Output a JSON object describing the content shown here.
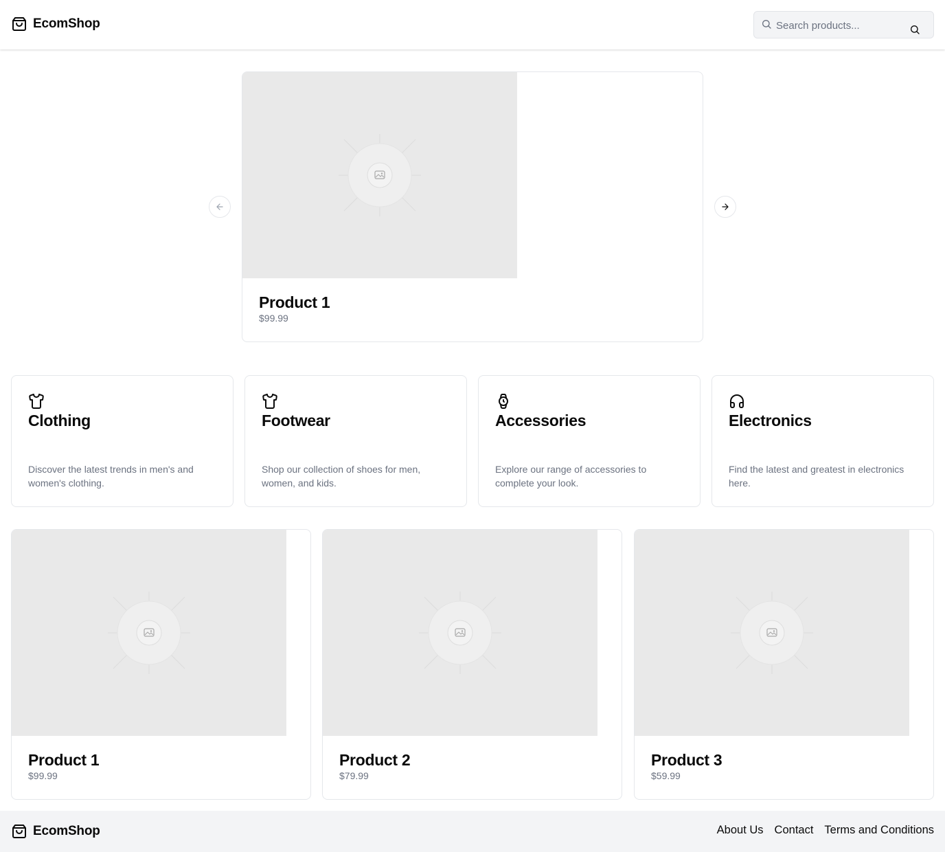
{
  "header": {
    "brand": "EcomShop",
    "search_placeholder": "Search products..."
  },
  "hero": {
    "slide_title": "Product 1",
    "slide_price": "$99.99",
    "prev_label": "Previous slide",
    "next_label": "Next slide"
  },
  "categories": [
    {
      "icon": "shirt-icon",
      "title": "Clothing",
      "description": "Discover the latest trends in men's and women's clothing."
    },
    {
      "icon": "shirt-icon",
      "title": "Footwear",
      "description": "Shop our collection of shoes for men, women, and kids."
    },
    {
      "icon": "watch-icon",
      "title": "Accessories",
      "description": "Explore our range of accessories to complete your look."
    },
    {
      "icon": "headphones-icon",
      "title": "Electronics",
      "description": "Find the latest and greatest in electronics here."
    }
  ],
  "products": [
    {
      "title": "Product 1",
      "price": "$99.99"
    },
    {
      "title": "Product 2",
      "price": "$79.99"
    },
    {
      "title": "Product 3",
      "price": "$59.99"
    }
  ],
  "footer": {
    "brand": "EcomShop",
    "links": [
      "About Us",
      "Contact",
      "Terms and Conditions"
    ]
  },
  "colors": {
    "placeholder_bg": "#e9e9e9",
    "border": "#e5e7eb",
    "muted_text": "#6b7280",
    "footer_bg": "#f3f4f6"
  }
}
